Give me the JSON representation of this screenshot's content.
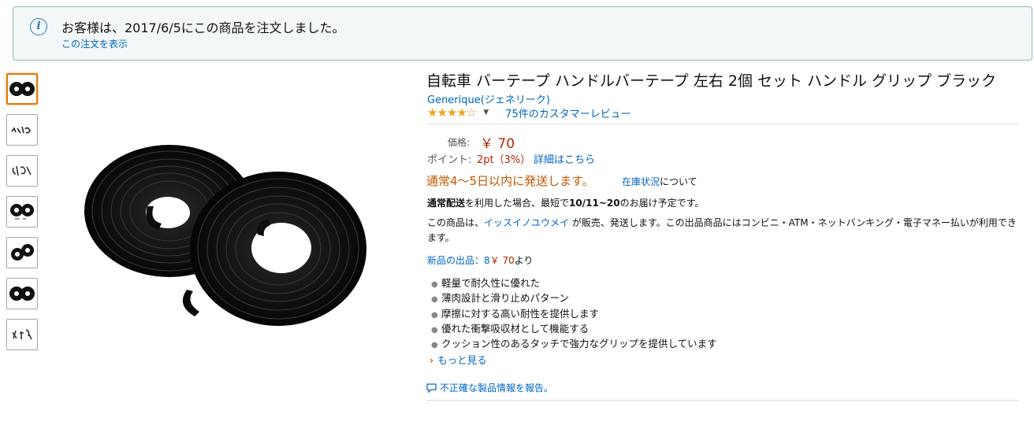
{
  "notice": {
    "message": "お客様は、2017/6/5にこの商品を注文しました。",
    "link": "この注文を表示",
    "icon": "info-icon"
  },
  "product": {
    "title": "自転車 バーテープ ハンドルバーテープ 左右 2個 セット ハンドル グリップ ブラック",
    "brand": "Generique(ジェネリーク)",
    "rating": 3.5,
    "rating_max": 5,
    "reviews": "75件のカスタマーレビュー",
    "price_label": "価格:",
    "price": "￥ 70",
    "points_label": "ポイント:",
    "points": "2pt（3%）",
    "points_link": "詳細はこちら",
    "shipping_time": "通常4～5日以内に発送します。",
    "stock_link": "在庫状況",
    "stock_suffix": "について",
    "delivery_bold1": "通常配送",
    "delivery_mid": "を利用した場合、最短で",
    "delivery_bold2": "10/11~20",
    "delivery_suffix": "のお届け予定です。",
    "seller_prefix": "この商品は、",
    "seller_name": "イッスイノユウメイ",
    "seller_suffix": " が販売、発送します。この出品商品にはコンビニ・ATM・ネットバンキング・電子マネー払いが利用できます。",
    "new_offers_link": "新品の出品：8",
    "new_offers_price": "￥ 70",
    "new_offers_suffix": "より",
    "bullets": [
      "軽量で耐久性に優れた",
      "薄肉設計と滑り止めパターン",
      "摩擦に対する高い耐性を提供します",
      "優れた衝撃吸収材として機能する",
      "クッション性のあるタッチで強力なグリップを提供しています"
    ],
    "see_more": "もっと見る",
    "report": "不正確な製品情報を報告。"
  },
  "thumbnails": [
    "thumbnail-1",
    "thumbnail-2",
    "thumbnail-3",
    "thumbnail-4",
    "thumbnail-5",
    "thumbnail-6",
    "thumbnail-7"
  ],
  "colors": {
    "link": "#0066c0",
    "price": "#b12704",
    "shipping": "#c45500",
    "star": "#f0a31a",
    "active_thumb": "#e77600"
  }
}
